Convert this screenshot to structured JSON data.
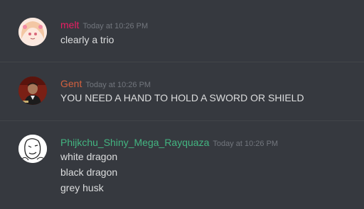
{
  "messages": [
    {
      "username": "melt",
      "username_color": "#e91e63",
      "timestamp": "Today at 10:26 PM",
      "avatar": "anime-girl-avatar",
      "lines": [
        "clearly a trio"
      ]
    },
    {
      "username": "Gent",
      "username_color": "#d3613f",
      "timestamp": "Today at 10:26 PM",
      "avatar": "man-portrait-avatar",
      "lines": [
        "YOU NEED A HAND TO HOLD A SWORD OR SHIELD"
      ]
    },
    {
      "username": "Phijkchu_Shiny_Mega_Rayquaza",
      "username_color": "#43b581",
      "timestamp": "Today at 10:26 PM",
      "avatar": "sketch-avatar",
      "lines": [
        "white dragon",
        "black dragon",
        "grey husk"
      ]
    }
  ]
}
